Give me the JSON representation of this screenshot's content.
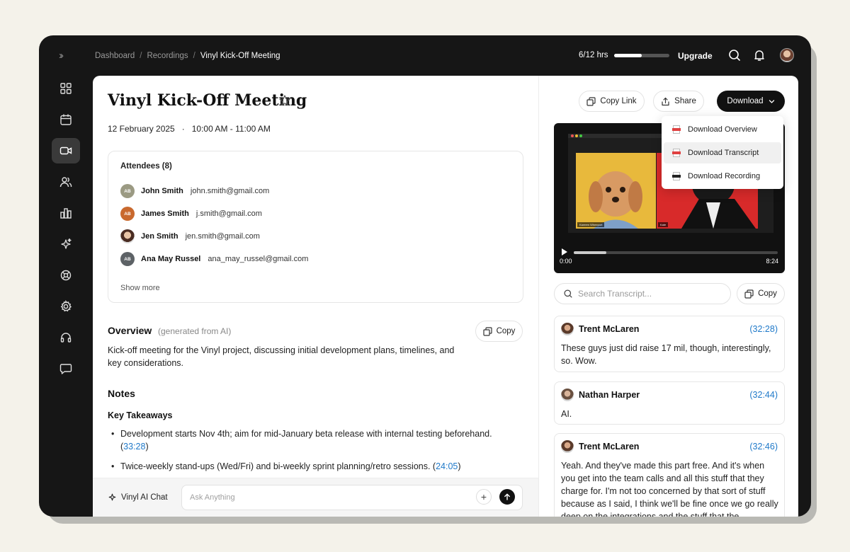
{
  "topbar": {
    "breadcrumb": [
      "Dashboard",
      "Recordings",
      "Vinyl Kick-Off Meeting"
    ],
    "hours_label": "6/12 hrs",
    "hours_progress": 0.5,
    "upgrade_label": "Upgrade"
  },
  "sidebar": {
    "items": [
      "grid-icon",
      "calendar-icon",
      "video-icon",
      "users-icon",
      "chart-icon",
      "sparkles-icon",
      "integration-icon",
      "settings-icon",
      "headset-icon",
      "chat-icon"
    ],
    "active": "video-icon"
  },
  "meeting": {
    "title": "Vinyl Kick-Off Meeting",
    "date": "12 February 2025",
    "separator": "·",
    "time": "10:00 AM - 11:00 AM"
  },
  "attendees": {
    "title": "Attendees (8)",
    "list": [
      {
        "initials": "AB",
        "name": "John Smith",
        "email": "john.smith@gmail.com",
        "color": "#9b9a83"
      },
      {
        "initials": "AB",
        "name": "James Smith",
        "email": "j.smith@gmail.com",
        "color": "#c9692e"
      },
      {
        "initials": "",
        "name": "Jen Smith",
        "email": "jen.smith@gmail.com",
        "color": "#7a5a4a"
      },
      {
        "initials": "AB",
        "name": "Ana May Russel",
        "email": "ana_may_russel@gmail.com",
        "color": "#5d6266"
      }
    ],
    "show_more": "Show more"
  },
  "overview": {
    "title": "Overview",
    "subtitle": "(generated from AI)",
    "copy_label": "Copy",
    "text": "Kick-off meeting for the Vinyl project, discussing initial development plans, timelines, and key considerations."
  },
  "notes": {
    "title": "Notes",
    "subtitle": "Key Takeaways",
    "bullets": [
      {
        "text": "Development starts Nov 4th; aim for mid-January beta release with internal testing beforehand. ",
        "ts": "33:28"
      },
      {
        "text": "Twice-weekly stand-ups (Wed/Fri) and bi-weekly sprint planning/retro sessions. ",
        "ts": "24:05"
      }
    ]
  },
  "chat": {
    "label": "Vinyl AI Chat",
    "placeholder": "Ask Anything"
  },
  "actions": {
    "copy_link": "Copy Link",
    "share": "Share",
    "download": "Download"
  },
  "download_menu": {
    "items": [
      {
        "label": "Download Overview",
        "type": "PDF",
        "color": "#e04040"
      },
      {
        "label": "Download Transcript",
        "type": "PDF",
        "color": "#e04040"
      },
      {
        "label": "Download Recording",
        "type": "MP4",
        "color": "#222222"
      }
    ]
  },
  "video": {
    "current_time": "0:00",
    "duration": "8:24",
    "progress": 0.16,
    "tile_labels": [
      "Kareem Wheeport",
      "Kate"
    ]
  },
  "transcript": {
    "search_placeholder": "Search Transcript...",
    "copy_label": "Copy",
    "entries": [
      {
        "speaker": "Trent McLaren",
        "ts": "(32:28)",
        "text": "These guys just did raise 17 mil, though, interestingly, so. Wow."
      },
      {
        "speaker": "Nathan Harper",
        "ts": "(32:44)",
        "text": "AI."
      },
      {
        "speaker": "Trent McLaren",
        "ts": "(32:46)",
        "text": "Yeah. And they've made this part free. And it's when you get into the team calls and all this stuff that they charge for. I'm not too concerned by that sort of stuff because as I said, I think we'll be fine once we go really deep on the integrations and the stuff that the"
      }
    ]
  }
}
